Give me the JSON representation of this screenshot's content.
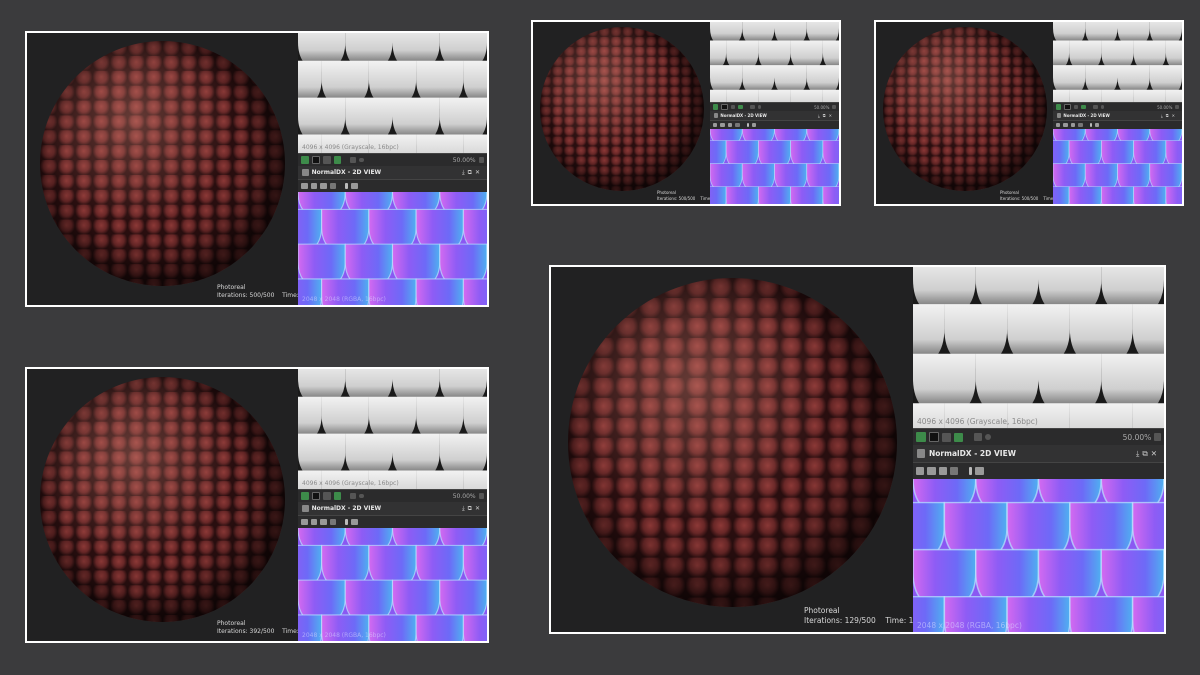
{
  "colors": {
    "background": "#3b3b3d",
    "frame": "#ffffff",
    "viewport_bg": "#212122",
    "sphere_base": "#6a2a2a",
    "normal_base": "#8a55f0"
  },
  "icons": [
    "toggle-icon",
    "grid-icon",
    "fit-icon",
    "pan-icon",
    "dot-icon",
    "lock-icon",
    "download-icon",
    "close-icon",
    "save-icon",
    "copy-icon",
    "layers-icon",
    "info-icon",
    "histogram-icon"
  ],
  "panels": [
    {
      "render_mode": "Photoreal",
      "iterations": "Iterations: 500/500",
      "time": "Time: 1m",
      "heightmap_info": "4096 x 4096 (Grayscale, 16bpc)",
      "zoom": "50.00%",
      "view_title": "NormalDX - 2D VIEW",
      "normalmap_info": "2048 x 2048 (RGBA, 16bpc)"
    },
    {
      "render_mode": "Photoreal",
      "iterations": "Iterations: 500/500",
      "time": "Time: 1m",
      "heightmap_info": "",
      "zoom": "50.00%",
      "view_title": "NormalDX - 2D VIEW",
      "normalmap_info": ""
    },
    {
      "render_mode": "Photoreal",
      "iterations": "Iterations: 500/500",
      "time": "Time: 1m",
      "heightmap_info": "",
      "zoom": "50.00%",
      "view_title": "NormalDX - 2D VIEW",
      "normalmap_info": ""
    },
    {
      "render_mode": "Photoreal",
      "iterations": "Iterations: 392/500",
      "time": "Time: 1m",
      "heightmap_info": "4096 x 4096 (Grayscale, 16bpc)",
      "zoom": "50.00%",
      "view_title": "NormalDX - 2D VIEW",
      "normalmap_info": "2048 x 2048 (RGBA, 16bpc)"
    },
    {
      "render_mode": "Photoreal",
      "iterations": "Iterations: 129/500",
      "time": "Time: 1m",
      "heightmap_info": "4096 x 4096 (Grayscale, 16bpc)",
      "zoom": "50.00%",
      "view_title": "NormalDX - 2D VIEW",
      "normalmap_info": "2048 x 2048 (RGBA, 16bpc)"
    }
  ]
}
